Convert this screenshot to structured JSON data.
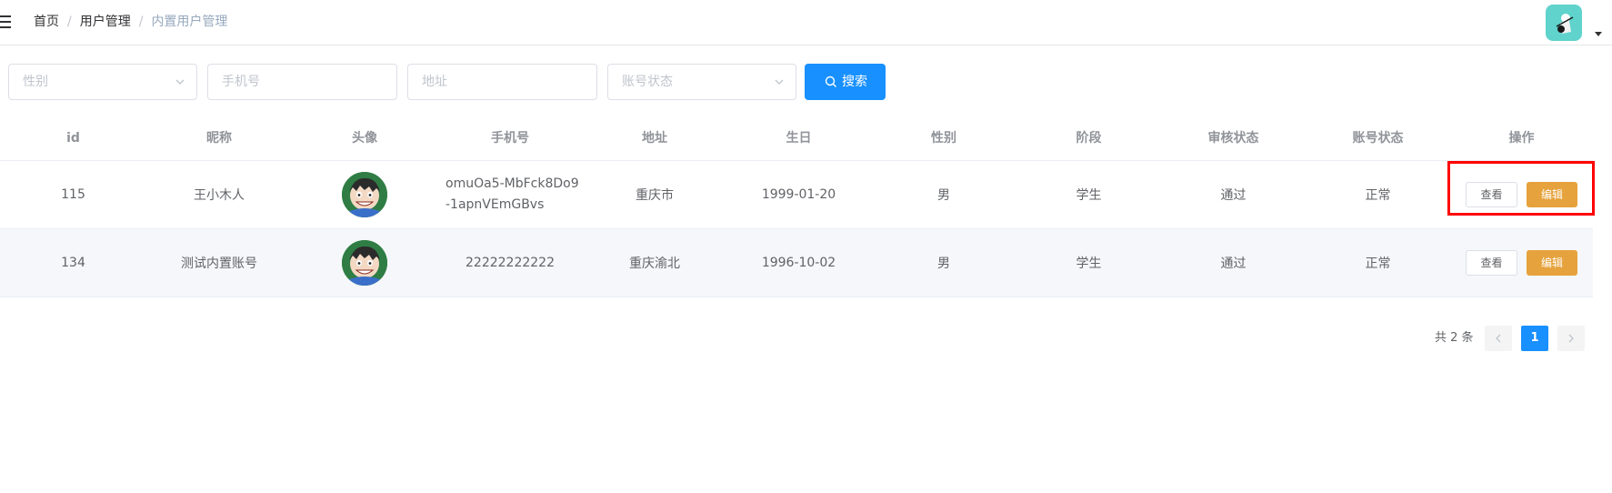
{
  "breadcrumb": {
    "items": [
      "首页",
      "用户管理"
    ],
    "current": "内置用户管理"
  },
  "filters": {
    "gender_placeholder": "性别",
    "phone_placeholder": "手机号",
    "address_placeholder": "地址",
    "status_placeholder": "账号状态",
    "search_label": "搜索"
  },
  "table": {
    "columns": [
      "id",
      "昵称",
      "头像",
      "手机号",
      "地址",
      "生日",
      "性别",
      "阶段",
      "审核状态",
      "账号状态",
      "操作"
    ],
    "rows": [
      {
        "id": "115",
        "nickname": "王小木人",
        "phone": "omuOa5-MbFck8Do9-1apnVEmGBvs",
        "address": "重庆市",
        "birthday": "1999-01-20",
        "gender": "男",
        "stage": "学生",
        "audit": "通过",
        "account": "正常",
        "view": "查看",
        "edit": "编辑"
      },
      {
        "id": "134",
        "nickname": "测试内置账号",
        "phone": "22222222222",
        "address": "重庆渝北",
        "birthday": "1996-10-02",
        "gender": "男",
        "stage": "学生",
        "audit": "通过",
        "account": "正常",
        "view": "查看",
        "edit": "编辑"
      }
    ]
  },
  "pagination": {
    "total": "共 2 条",
    "current_page": "1"
  },
  "colors": {
    "primary": "#1890ff",
    "warning": "#e6a23c",
    "highlight": "#ff0000"
  }
}
